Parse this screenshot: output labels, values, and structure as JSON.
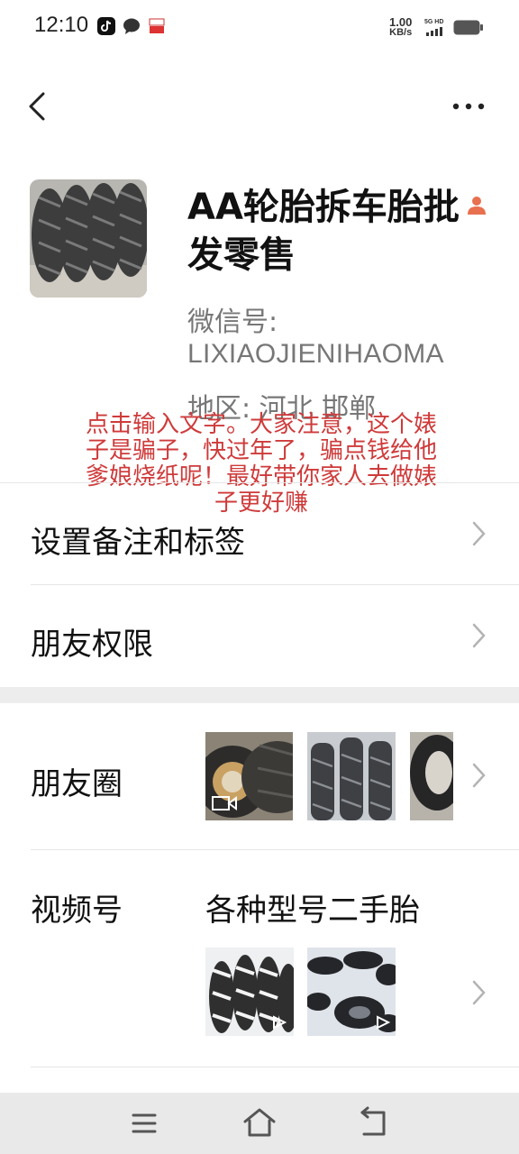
{
  "status_bar": {
    "time": "12:10",
    "net_speed_value": "1.00",
    "net_speed_unit": "KB/s",
    "signal_label": "5G HD",
    "icons": [
      "douyin-icon",
      "chat-bubble-icon",
      "app-badge-icon",
      "signal-icon",
      "battery-icon"
    ]
  },
  "header": {
    "back_icon": "back-chevron-icon",
    "more_icon": "more-dots-icon"
  },
  "profile": {
    "name": "AA轮胎拆车胎批发零售",
    "wechat_id_label": "微信号:",
    "wechat_id": "LIXIAOJIENIHAOMA",
    "region": "地区:  河北  邯郸",
    "gender_icon": "person-icon"
  },
  "overlay_text": "点击输入文字。大家注意，这个婊子是骗子，快过年了，骗点钱给他爹娘烧纸呢！最好带你家人去做婊子更好赚",
  "menu": {
    "remark_tags": "设置备注和标签",
    "friend_permissions": "朋友权限",
    "moments": "朋友圈",
    "channels": "视频号",
    "channels_caption": "各种型号二手胎"
  },
  "colors": {
    "overlay": "#cf3a3a",
    "gender_icon": "#e8704f",
    "divider": "#e6e6e6",
    "section_gap": "#ededed",
    "nav_bg": "#e9e9e9"
  },
  "bottom_nav": {
    "icons": [
      "menu-lines-icon",
      "home-icon",
      "back-arrow-icon"
    ]
  }
}
